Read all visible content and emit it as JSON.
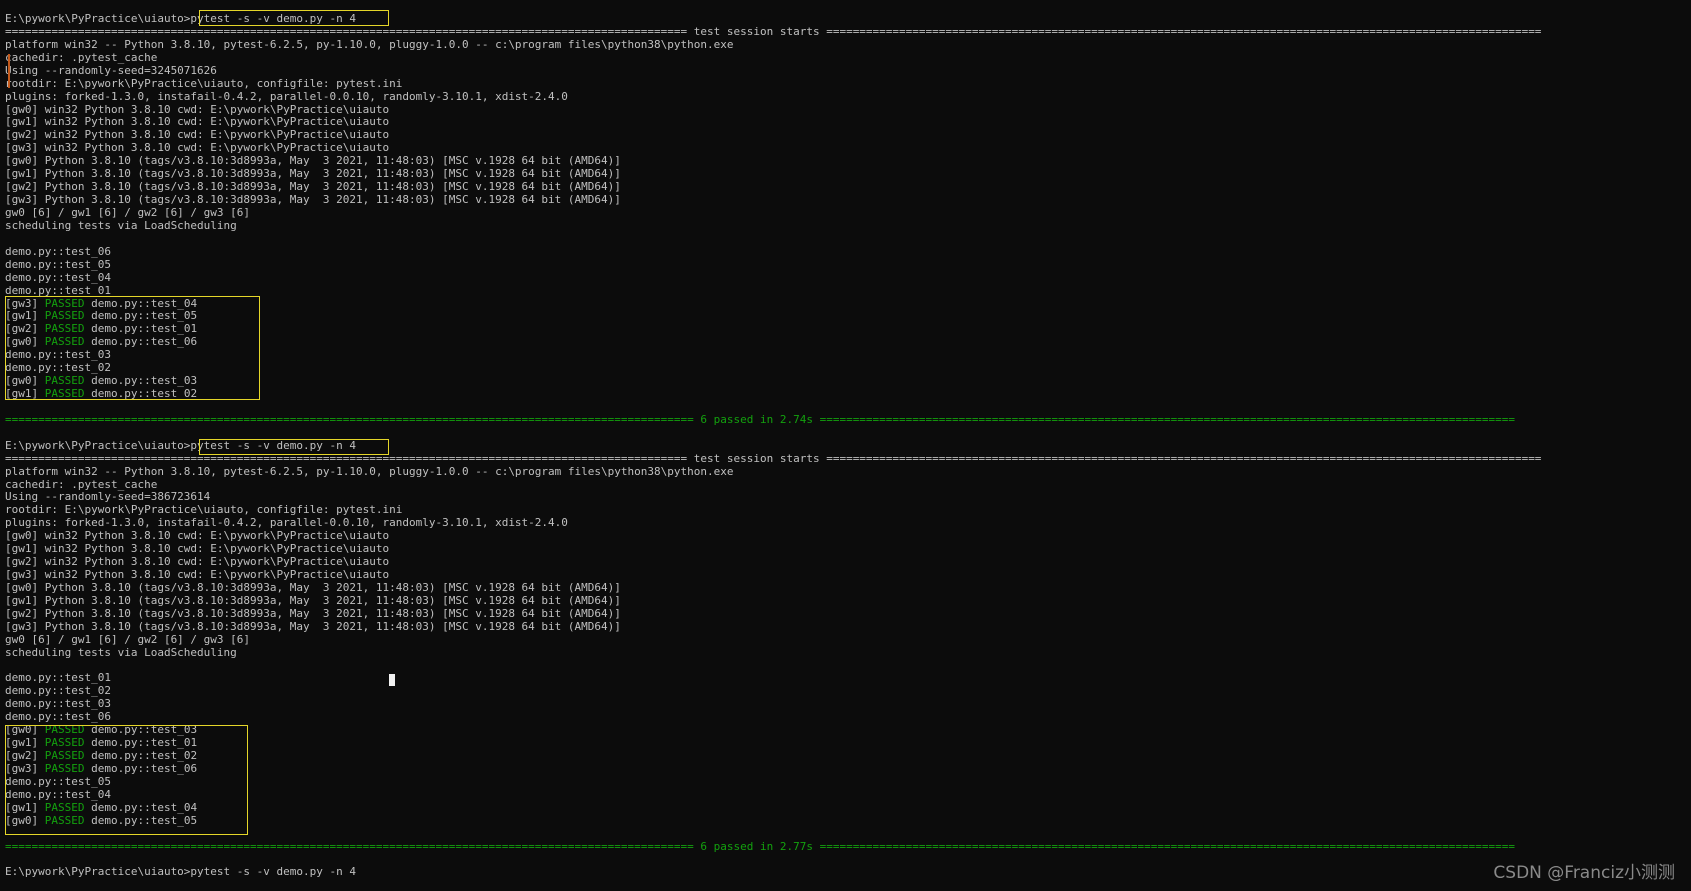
{
  "terminal": {
    "background": "#0c0c0c",
    "text_color": "#c0c0c0",
    "pass_color": "#13a10e",
    "highlight_color": "#e5d629",
    "lines": [
      {
        "text": "E:\\pywork\\PyPractice\\uiauto>pytest -s -v demo.py -n 4",
        "kind": "prompt"
      },
      {
        "text": "======================================================================================================= test session starts ============================================================================================================",
        "kind": "plain"
      },
      {
        "text": "platform win32 -- Python 3.8.10, pytest-6.2.5, py-1.10.0, pluggy-1.0.0 -- c:\\program files\\python38\\python.exe",
        "kind": "plain"
      },
      {
        "text": "cachedir: .pytest_cache",
        "kind": "plain"
      },
      {
        "text": "Using --randomly-seed=3245071626",
        "kind": "plain"
      },
      {
        "text": "rootdir: E:\\pywork\\PyPractice\\uiauto, configfile: pytest.ini",
        "kind": "plain"
      },
      {
        "text": "plugins: forked-1.3.0, instafail-0.4.2, parallel-0.0.10, randomly-3.10.1, xdist-2.4.0",
        "kind": "plain"
      },
      {
        "text": "[gw0] win32 Python 3.8.10 cwd: E:\\pywork\\PyPractice\\uiauto",
        "kind": "plain"
      },
      {
        "text": "[gw1] win32 Python 3.8.10 cwd: E:\\pywork\\PyPractice\\uiauto",
        "kind": "plain"
      },
      {
        "text": "[gw2] win32 Python 3.8.10 cwd: E:\\pywork\\PyPractice\\uiauto",
        "kind": "plain"
      },
      {
        "text": "[gw3] win32 Python 3.8.10 cwd: E:\\pywork\\PyPractice\\uiauto",
        "kind": "plain"
      },
      {
        "text": "[gw0] Python 3.8.10 (tags/v3.8.10:3d8993a, May  3 2021, 11:48:03) [MSC v.1928 64 bit (AMD64)]",
        "kind": "plain"
      },
      {
        "text": "[gw1] Python 3.8.10 (tags/v3.8.10:3d8993a, May  3 2021, 11:48:03) [MSC v.1928 64 bit (AMD64)]",
        "kind": "plain"
      },
      {
        "text": "[gw2] Python 3.8.10 (tags/v3.8.10:3d8993a, May  3 2021, 11:48:03) [MSC v.1928 64 bit (AMD64)]",
        "kind": "plain"
      },
      {
        "text": "[gw3] Python 3.8.10 (tags/v3.8.10:3d8993a, May  3 2021, 11:48:03) [MSC v.1928 64 bit (AMD64)]",
        "kind": "plain"
      },
      {
        "text": "gw0 [6] / gw1 [6] / gw2 [6] / gw3 [6]",
        "kind": "plain"
      },
      {
        "text": "scheduling tests via LoadScheduling",
        "kind": "plain"
      },
      {
        "text": "",
        "kind": "plain"
      },
      {
        "text": "demo.py::test_06",
        "kind": "plain"
      },
      {
        "text": "demo.py::test_05",
        "kind": "plain"
      },
      {
        "text": "demo.py::test_04",
        "kind": "plain"
      },
      {
        "text": "demo.py::test_01",
        "kind": "plain"
      },
      {
        "text": "[gw3] PASSED demo.py::test_04",
        "kind": "pass"
      },
      {
        "text": "[gw1] PASSED demo.py::test_05",
        "kind": "pass"
      },
      {
        "text": "[gw2] PASSED demo.py::test_01",
        "kind": "pass"
      },
      {
        "text": "[gw0] PASSED demo.py::test_06",
        "kind": "pass"
      },
      {
        "text": "demo.py::test_03",
        "kind": "plain"
      },
      {
        "text": "demo.py::test_02",
        "kind": "plain"
      },
      {
        "text": "[gw0] PASSED demo.py::test_03",
        "kind": "pass"
      },
      {
        "text": "[gw1] PASSED demo.py::test_02",
        "kind": "pass"
      },
      {
        "text": "",
        "kind": "plain"
      },
      {
        "text": "======================================================================================================== 6 passed in 2.74s =========================================================================================================",
        "kind": "summary"
      },
      {
        "text": "",
        "kind": "plain"
      },
      {
        "text": "E:\\pywork\\PyPractice\\uiauto>pytest -s -v demo.py -n 4",
        "kind": "prompt"
      },
      {
        "text": "======================================================================================================= test session starts ============================================================================================================",
        "kind": "plain"
      },
      {
        "text": "platform win32 -- Python 3.8.10, pytest-6.2.5, py-1.10.0, pluggy-1.0.0 -- c:\\program files\\python38\\python.exe",
        "kind": "plain"
      },
      {
        "text": "cachedir: .pytest_cache",
        "kind": "plain"
      },
      {
        "text": "Using --randomly-seed=386723614",
        "kind": "plain"
      },
      {
        "text": "rootdir: E:\\pywork\\PyPractice\\uiauto, configfile: pytest.ini",
        "kind": "plain"
      },
      {
        "text": "plugins: forked-1.3.0, instafail-0.4.2, parallel-0.0.10, randomly-3.10.1, xdist-2.4.0",
        "kind": "plain"
      },
      {
        "text": "[gw0] win32 Python 3.8.10 cwd: E:\\pywork\\PyPractice\\uiauto",
        "kind": "plain"
      },
      {
        "text": "[gw1] win32 Python 3.8.10 cwd: E:\\pywork\\PyPractice\\uiauto",
        "kind": "plain"
      },
      {
        "text": "[gw2] win32 Python 3.8.10 cwd: E:\\pywork\\PyPractice\\uiauto",
        "kind": "plain"
      },
      {
        "text": "[gw3] win32 Python 3.8.10 cwd: E:\\pywork\\PyPractice\\uiauto",
        "kind": "plain"
      },
      {
        "text": "[gw0] Python 3.8.10 (tags/v3.8.10:3d8993a, May  3 2021, 11:48:03) [MSC v.1928 64 bit (AMD64)]",
        "kind": "plain"
      },
      {
        "text": "[gw1] Python 3.8.10 (tags/v3.8.10:3d8993a, May  3 2021, 11:48:03) [MSC v.1928 64 bit (AMD64)]",
        "kind": "plain"
      },
      {
        "text": "[gw2] Python 3.8.10 (tags/v3.8.10:3d8993a, May  3 2021, 11:48:03) [MSC v.1928 64 bit (AMD64)]",
        "kind": "plain"
      },
      {
        "text": "[gw3] Python 3.8.10 (tags/v3.8.10:3d8993a, May  3 2021, 11:48:03) [MSC v.1928 64 bit (AMD64)]",
        "kind": "plain"
      },
      {
        "text": "gw0 [6] / gw1 [6] / gw2 [6] / gw3 [6]",
        "kind": "plain"
      },
      {
        "text": "scheduling tests via LoadScheduling",
        "kind": "plain"
      },
      {
        "text": "",
        "kind": "plain"
      },
      {
        "text": "demo.py::test_01",
        "kind": "plain"
      },
      {
        "text": "demo.py::test_02",
        "kind": "plain"
      },
      {
        "text": "demo.py::test_03",
        "kind": "plain"
      },
      {
        "text": "demo.py::test_06",
        "kind": "plain"
      },
      {
        "text": "[gw0] PASSED demo.py::test_03",
        "kind": "pass"
      },
      {
        "text": "[gw1] PASSED demo.py::test_01",
        "kind": "pass"
      },
      {
        "text": "[gw2] PASSED demo.py::test_02",
        "kind": "pass"
      },
      {
        "text": "[gw3] PASSED demo.py::test_06",
        "kind": "pass"
      },
      {
        "text": "demo.py::test_05",
        "kind": "plain"
      },
      {
        "text": "demo.py::test_04",
        "kind": "plain"
      },
      {
        "text": "[gw1] PASSED demo.py::test_04",
        "kind": "pass"
      },
      {
        "text": "[gw0] PASSED demo.py::test_05",
        "kind": "pass"
      },
      {
        "text": "",
        "kind": "plain"
      },
      {
        "text": "======================================================================================================== 6 passed in 2.77s =========================================================================================================",
        "kind": "summary"
      },
      {
        "text": "",
        "kind": "plain"
      },
      {
        "text": "E:\\pywork\\PyPractice\\uiauto>pytest -s -v demo.py -n 4",
        "kind": "prompt"
      }
    ]
  },
  "watermark": "CSDN @Franciz小测测"
}
